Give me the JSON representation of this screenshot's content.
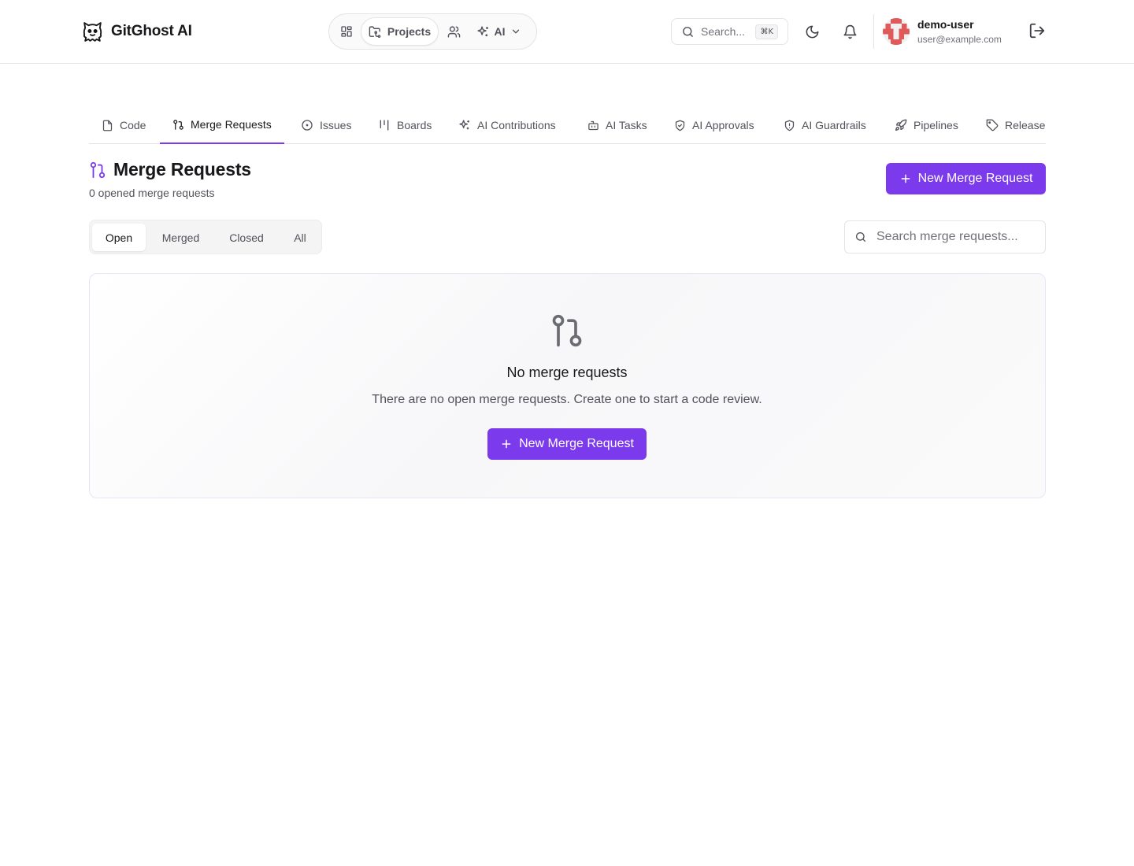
{
  "app": {
    "name": "GitGhost AI"
  },
  "topnav": {
    "projects_label": "Projects",
    "ai_label": "AI",
    "search_placeholder": "Search...",
    "search_shortcut": "⌘K"
  },
  "user": {
    "name": "demo-user",
    "email": "user@example.com"
  },
  "tabs": [
    {
      "label": "Code",
      "icon": "file-icon"
    },
    {
      "label": "Merge Requests",
      "icon": "git-pull-request-icon",
      "active": true
    },
    {
      "label": "Issues",
      "icon": "circle-dot-icon"
    },
    {
      "label": "Boards",
      "icon": "kanban-icon"
    },
    {
      "label": "AI Contributions",
      "icon": "sparkles-icon"
    },
    {
      "label": "AI Tasks",
      "icon": "bot-icon"
    },
    {
      "label": "AI Approvals",
      "icon": "shield-check-icon"
    },
    {
      "label": "AI Guardrails",
      "icon": "shield-alert-icon"
    },
    {
      "label": "Pipelines",
      "icon": "rocket-icon"
    },
    {
      "label": "Release",
      "icon": "tag-icon"
    }
  ],
  "page": {
    "title": "Merge Requests",
    "subtitle": "0 opened merge requests",
    "new_button_label": "New Merge Request"
  },
  "filters": {
    "options": [
      "Open",
      "Merged",
      "Closed",
      "All"
    ],
    "selected": "Open"
  },
  "mr_search": {
    "placeholder": "Search merge requests..."
  },
  "empty_state": {
    "title": "No merge requests",
    "description": "There are no open merge requests. Create one to start a code review.",
    "button_label": "New Merge Request"
  },
  "colors": {
    "accent": "#7c3aed",
    "border": "#e4e4e7",
    "muted_text": "#52525b"
  }
}
